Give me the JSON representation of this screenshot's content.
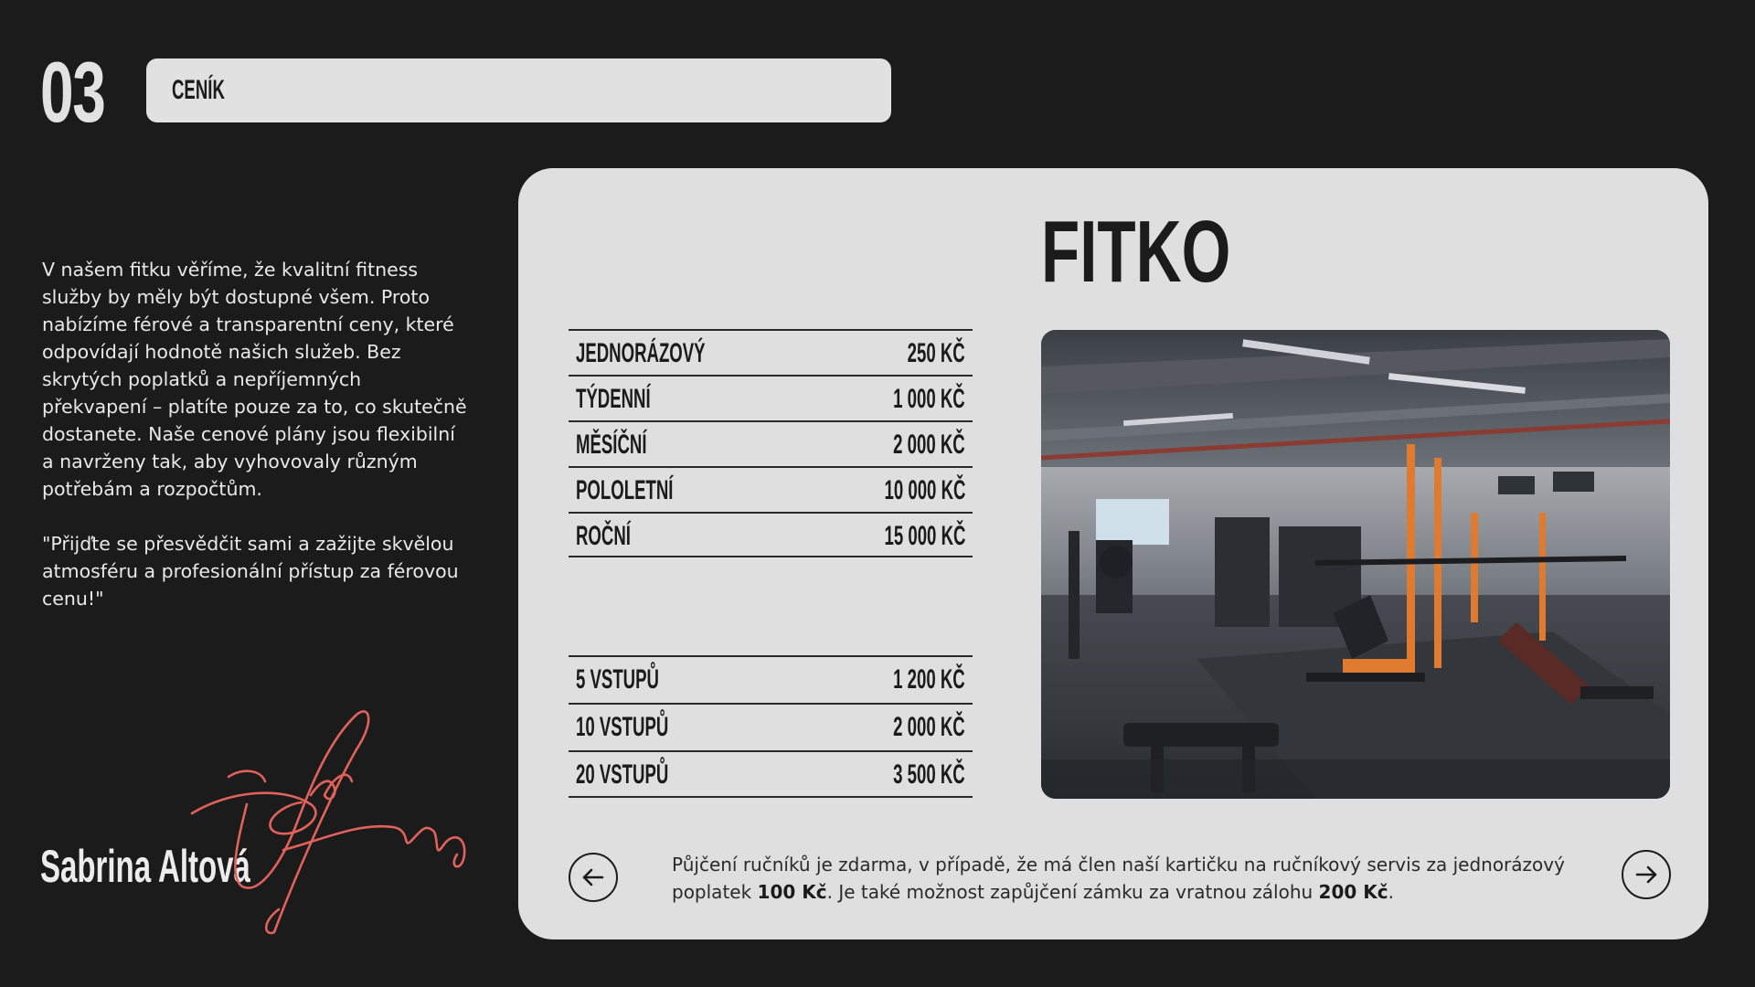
{
  "header": {
    "section_number": "03",
    "section_title": "CENÍK"
  },
  "intro": {
    "paragraph_1": "V našem fitku věříme, že kvalitní fitness služby by měly být dostupné všem. Proto nabízíme férové a transparentní ceny, které odpovídají hodnotě našich služeb. Bez skrytých poplatků a nepříjemných překvapení – platíte pouze za to, co skutečně dostanete. Naše cenové plány jsou flexibilní a navrženy tak, aby vyhovovaly různým potřebám a rozpočtům.",
    "paragraph_2": "\"Přijďte se přesvědčit sami a zažijte skvělou atmosféru a profesionální přístup za férovou cenu!\""
  },
  "signature": {
    "name": "Sabrina Altová"
  },
  "card": {
    "title": "FITKO",
    "memberships": [
      {
        "name": "JEDNORÁZOVÝ",
        "price": "250 KČ"
      },
      {
        "name": "TÝDENNÍ",
        "price": "1 000 KČ"
      },
      {
        "name": "MĚSÍČNÍ",
        "price": "2 000 KČ"
      },
      {
        "name": "POLOLETNÍ",
        "price": "10 000 KČ"
      },
      {
        "name": "ROČNÍ",
        "price": "15 000 KČ"
      }
    ],
    "entries": [
      {
        "name": "5 VSTUPŮ",
        "price": "1 200 KČ"
      },
      {
        "name": "10 VSTUPŮ",
        "price": "2 000 KČ"
      },
      {
        "name": "20 VSTUPŮ",
        "price": "3 500 KČ"
      }
    ],
    "footnote": {
      "part_1": "Půjčení ručníků je zdarma, v případě, že má člen naší kartičku na ručníkový servis za jednorázový poplatek ",
      "bold_1": "100 Kč",
      "part_2": ". Je také možnost zapůjčení zámku za vratnou zálohu ",
      "bold_2": "200 Kč",
      "part_3": "."
    },
    "nav": {
      "prev_icon": "arrow-left-icon",
      "next_icon": "arrow-right-icon"
    }
  },
  "colors": {
    "background": "#1b1b1c",
    "card": "#dfdfdf",
    "signature_accent": "#e0625a",
    "equipment_accent": "#e07a2f"
  }
}
